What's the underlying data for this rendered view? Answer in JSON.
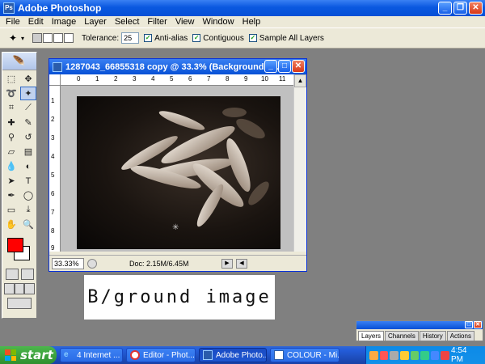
{
  "app": {
    "title": "Adobe Photoshop"
  },
  "menu": [
    "File",
    "Edit",
    "Image",
    "Layer",
    "Select",
    "Filter",
    "View",
    "Window",
    "Help"
  ],
  "options": {
    "tolerance_label": "Tolerance:",
    "tolerance_value": "25",
    "antialias_label": "Anti-alias",
    "contiguous_label": "Contiguous",
    "sample_all_label": "Sample All Layers",
    "antialias_checked": true,
    "contiguous_checked": true,
    "sample_all_checked": true
  },
  "document": {
    "title": "1287043_66855318 copy @ 33.3% (Background c...",
    "zoom": "33.33%",
    "doc_info": "Doc: 2.15M/6.45M",
    "ruler_h": [
      "0",
      "1",
      "2",
      "3",
      "4",
      "5",
      "6",
      "7",
      "8",
      "9",
      "10",
      "11"
    ],
    "ruler_v": [
      "1",
      "2",
      "3",
      "4",
      "5",
      "6",
      "7",
      "8",
      "9"
    ]
  },
  "colors": {
    "foreground": "#ff0000",
    "background": "#ffffff",
    "accent": "#0650d6"
  },
  "caption": "B/ground image",
  "palette": {
    "tabs": [
      "Layers",
      "Channels",
      "History",
      "Actions"
    ]
  },
  "taskbar": {
    "start": "start",
    "tasks": [
      "4 Internet ...",
      "Editor - Phot...",
      "Adobe Photo...",
      "COLOUR - Mi..."
    ],
    "clock": "4:54 PM"
  }
}
